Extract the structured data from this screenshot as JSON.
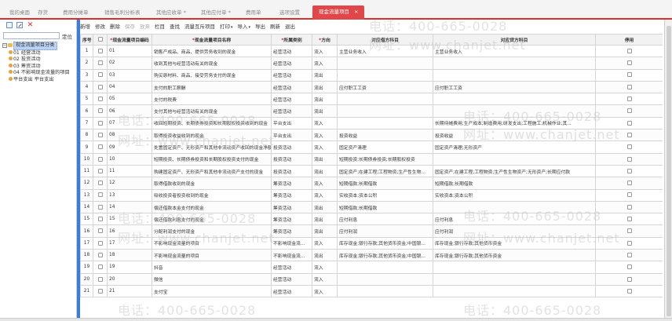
{
  "tabs": [
    {
      "label": "我的桌面",
      "active": false
    },
    {
      "label": "存货",
      "active": false
    },
    {
      "label": "费用分摊单",
      "active": false
    },
    {
      "label": "销售毛利分析表",
      "active": false
    },
    {
      "label": "其他应收单 *",
      "active": false
    },
    {
      "label": "其他应付单 *",
      "active": false
    },
    {
      "label": "费用单",
      "active": false
    },
    {
      "label": "选项设置",
      "active": false
    },
    {
      "label": "现金流量项目",
      "active": true
    }
  ],
  "tab_close": "×",
  "left_panel": {
    "tools": [
      "new-icon",
      "edit-icon",
      "delete-icon"
    ],
    "delete_glyph": "✕",
    "search_placeholder": "",
    "locate_label": "定位",
    "tree": {
      "minus_glyph": "−",
      "root": "现金流量项目分类",
      "children": [
        {
          "label": "01 经营活动",
          "indent": 1
        },
        {
          "label": "02 投资活动",
          "indent": 1
        },
        {
          "label": "03 筹资活动",
          "indent": 1
        },
        {
          "label": "04 不影响现金流量的项目",
          "indent": 1
        },
        {
          "label": "平台支出 平台支出",
          "indent": 1
        }
      ]
    }
  },
  "toolbar": [
    {
      "label": "新增",
      "disabled": false
    },
    {
      "label": "修改",
      "disabled": false
    },
    {
      "label": "删除",
      "disabled": false
    },
    {
      "label": "保存",
      "disabled": true
    },
    {
      "label": "放弃",
      "disabled": true
    },
    {
      "label": "栏目",
      "disabled": false
    },
    {
      "label": "查找",
      "disabled": false
    },
    {
      "label": "流量互斥项目",
      "disabled": false
    },
    {
      "label": "打印",
      "disabled": false,
      "caret": "▾"
    },
    {
      "label": "导入",
      "disabled": false,
      "caret": "▾"
    },
    {
      "label": "导出",
      "disabled": false
    },
    {
      "label": "刷新",
      "disabled": false
    },
    {
      "label": "退出",
      "disabled": false
    }
  ],
  "table": {
    "columns": [
      {
        "label": "序号",
        "required": false
      },
      {
        "label": "",
        "required": false,
        "checkbox": true
      },
      {
        "label": "现金流量项目编码",
        "required": true
      },
      {
        "label": "现金流量项目名称",
        "required": true
      },
      {
        "label": "所属类别",
        "required": true
      },
      {
        "label": "方向",
        "required": true
      },
      {
        "label": "对应借方科目",
        "required": false
      },
      {
        "label": "对应贷方科目",
        "required": false
      },
      {
        "label": "停用",
        "required": false
      }
    ],
    "required_mark": "*",
    "rows": [
      [
        "1",
        "01",
        "销售产成品、商品、提供劳务收到的现金",
        "经营活动",
        "流入",
        "主营业务收入",
        "主营业务收入"
      ],
      [
        "2",
        "02",
        "收到其他与经营活动有关的现金",
        "经营活动",
        "流入",
        "",
        ""
      ],
      [
        "3",
        "03",
        "购买原材料、商品、接受劳务支付的现金",
        "经营活动",
        "流出",
        "",
        ""
      ],
      [
        "4",
        "04",
        "支付的职工薪酬",
        "经营活动",
        "流出",
        "应付职工工资",
        "应付职工工资"
      ],
      [
        "5",
        "05",
        "支付的税费",
        "经营活动",
        "流出",
        "",
        ""
      ],
      [
        "6",
        "06",
        "支付其他与经营活动有关的现金",
        "经营活动",
        "流出",
        "",
        ""
      ],
      [
        "7",
        "07",
        "收回短期投资、长期债券投资和长期股权投资收到的现金",
        "平台支出",
        "流入",
        "",
        "长期待摊费用;生产成本;制造费用;研发支出;工程施工;机械作业;其..."
      ],
      [
        "8",
        "08",
        "取得投资收益收到的现金",
        "平台支出",
        "流入",
        "投资收益",
        "投资收益"
      ],
      [
        "9",
        "09",
        "处置固定资产、无形资产和其他非流动资产收回的现金净额",
        "投资活动",
        "流入",
        "固定资产清理",
        "固定资产清理;无形资产"
      ],
      [
        "10",
        "10",
        "短期投资、长期债券投资和长期股权投资支付的现金",
        "投资活动",
        "流出",
        "短期投资;长期债券投资;长期股权投资",
        ""
      ],
      [
        "11",
        "11",
        "购建固定资产、无形资产和其他非流动资产支付的现金",
        "投资活动",
        "流出",
        "固定资产;在建工程;工程物资;生产性生物...",
        "固定资产;在建工程;工程物资;生产性生物资产;无形资产;长期应付款"
      ],
      [
        "12",
        "12",
        "取得借款收到的现金",
        "筹资活动",
        "流入",
        "短期借款;长期借款",
        "短期借款;长期借款"
      ],
      [
        "13",
        "13",
        "吸收投资者投资收到的现金",
        "筹资活动",
        "流入",
        "实收资本;资本公积",
        "实收资本;资本公积"
      ],
      [
        "14",
        "14",
        "偿还借款本金支付的现金",
        "筹资活动",
        "流出",
        "短期借款;长期借款",
        ""
      ],
      [
        "15",
        "15",
        "偿还借款利息支付的现金",
        "筹资活动",
        "流出",
        "应付利息",
        "应付利息"
      ],
      [
        "16",
        "16",
        "分配利润支付的现金",
        "筹资活动",
        "流出",
        "应付利润",
        "应付利润"
      ],
      [
        "17",
        "17",
        "不影响现金流量的项目",
        "不影响现金流...",
        "流入",
        "库存现金;银行存款;其他货币资金;中国银...",
        "库存现金;银行存款;其他货币资金"
      ],
      [
        "18",
        "18",
        "不影响现金流量的项目",
        "不影响现金流...",
        "流出",
        "库存现金;银行存款;其他货币资金;中国银...",
        "库存现金;银行存款;其他货币资金"
      ],
      [
        "19",
        "19",
        "抖音",
        "经营活动",
        "流入",
        "",
        ""
      ],
      [
        "20",
        "20",
        "微信",
        "经营活动",
        "流入",
        "",
        ""
      ],
      [
        "21",
        "21",
        "支付宝",
        "经营活动",
        "流入",
        "",
        ""
      ]
    ]
  },
  "watermark": {
    "phone": "电话：400-665-0028",
    "site": "网址：www.chanjet.net"
  },
  "colors": {
    "accent": "#e0464a",
    "splitter": "#3a7fd5",
    "tree_selected": "#bcd3f5"
  }
}
